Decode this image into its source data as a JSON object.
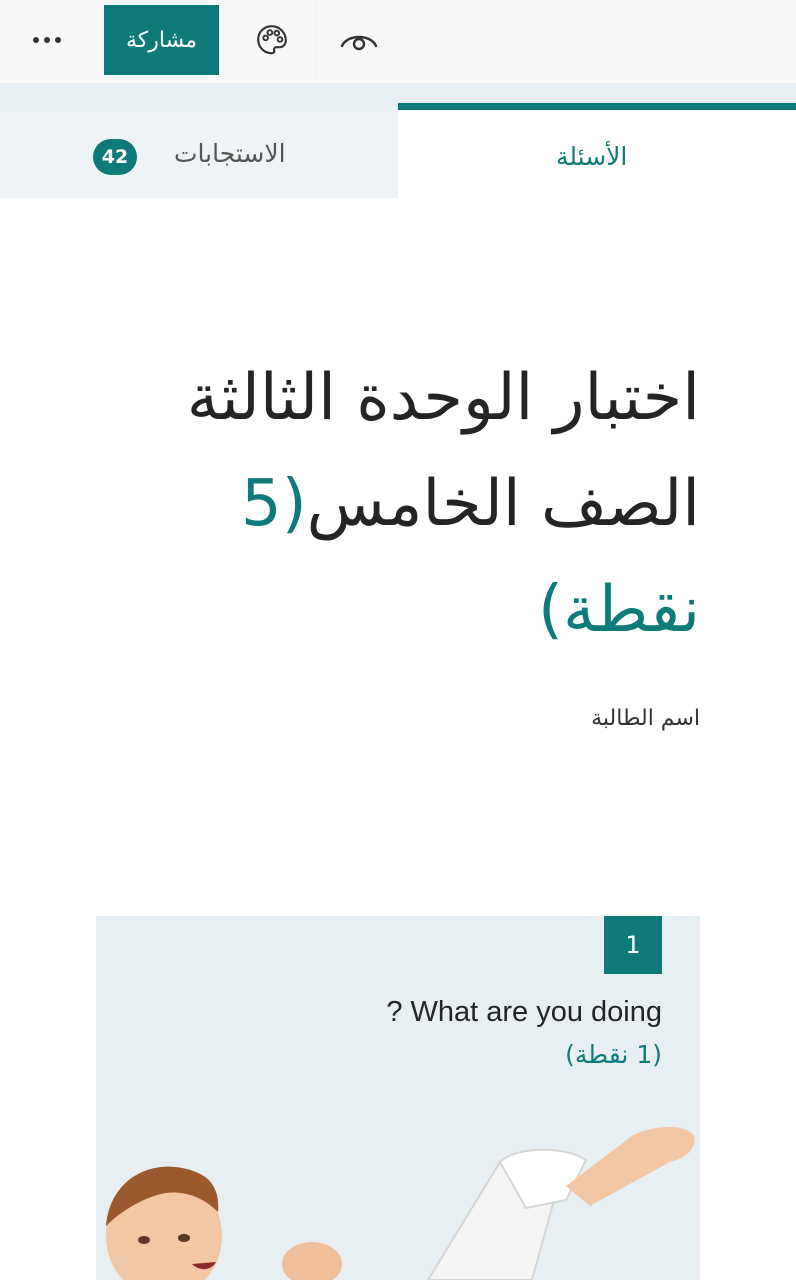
{
  "toolbar": {
    "share_label": "مشاركة",
    "more_icon": "more-horizontal-icon",
    "theme_icon": "palette-icon",
    "preview_icon": "eye-icon"
  },
  "tabs": {
    "questions_label": "الأسئلة",
    "responses_label": "الاستجابات",
    "responses_count": "42"
  },
  "form": {
    "title_text": "اختبار الوحدة الثالثة الصف الخامس",
    "title_points": "(5 نقطة)",
    "description": "اسم الطالبة"
  },
  "question": {
    "number": "1",
    "text": "? What are you doing",
    "points": "(1 نقطة)"
  },
  "colors": {
    "accent": "#0e7a7a",
    "card_bg": "#e7eff2",
    "toolbar_bg": "#f8f8f8"
  }
}
